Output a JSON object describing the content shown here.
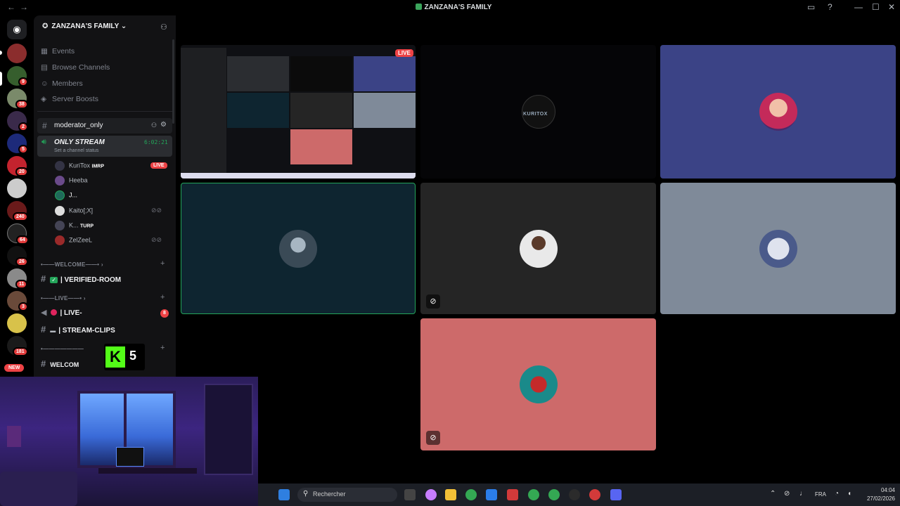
{
  "window": {
    "title": "ZANZANA'S FAMILY",
    "back": "←",
    "forward": "→",
    "minimize": "—",
    "maximize": "☐",
    "close": "✕"
  },
  "rail": {
    "new_label": "NEW",
    "badges": [
      "9",
      "38",
      "2",
      "5",
      "20",
      "240",
      "64",
      "26",
      "11",
      "3",
      "181"
    ]
  },
  "sidebar": {
    "server_name": "ZANZANA'S FAMILY",
    "nav": [
      {
        "label": "Events",
        "icon": "calendar-icon"
      },
      {
        "label": "Browse Channels",
        "icon": "browse-icon"
      },
      {
        "label": "Members",
        "icon": "members-icon"
      },
      {
        "label": "Server Boosts",
        "icon": "boost-icon"
      }
    ],
    "text_channel": "moderator_only",
    "voice_channel": {
      "name": "ONLY STREAM",
      "status": "Set a channel status",
      "timer": "6:02:21"
    },
    "voice_users": [
      {
        "name": "KuriTox",
        "tag": "IMRP",
        "live": "LIVE"
      },
      {
        "name": "Heeba"
      },
      {
        "name": "J..."
      },
      {
        "name": "Kaito[;X]"
      },
      {
        "name": "K...",
        "tag": "TURP"
      },
      {
        "name": "ZelZeeL"
      }
    ],
    "categories": [
      {
        "label": "•——WELCOME——•",
        "channels": [
          {
            "name": "| VERIFIED-ROOM"
          }
        ]
      },
      {
        "label": "•——LIVE——•",
        "channels": [
          {
            "name": "| LIVE-",
            "count": "8"
          },
          {
            "name": "| STREAM-CLIPS"
          }
        ]
      },
      {
        "label": "•———————",
        "channels": [
          {
            "name": "WELCOM"
          }
        ]
      }
    ],
    "overlay_counter": "5"
  },
  "stage": {
    "live_label": "LIVE",
    "tiles": [
      {
        "name": "stream-preview",
        "color": "#0f1014"
      },
      {
        "name": "kuritox",
        "color": "#050507",
        "logo_text": "KURITOX"
      },
      {
        "name": "heeba",
        "color": "#3b4386"
      },
      {
        "name": "user-teal",
        "color": "#0e2530"
      },
      {
        "name": "user-dark",
        "color": "#252525"
      },
      {
        "name": "user-grey",
        "color": "#7f8a99"
      },
      {
        "name": "user-pink",
        "color": "#cd6a6a"
      }
    ]
  },
  "taskbar": {
    "search_placeholder": "Rechercher",
    "lang": "FRA",
    "time": "04:04",
    "date": "27/02/2026"
  }
}
